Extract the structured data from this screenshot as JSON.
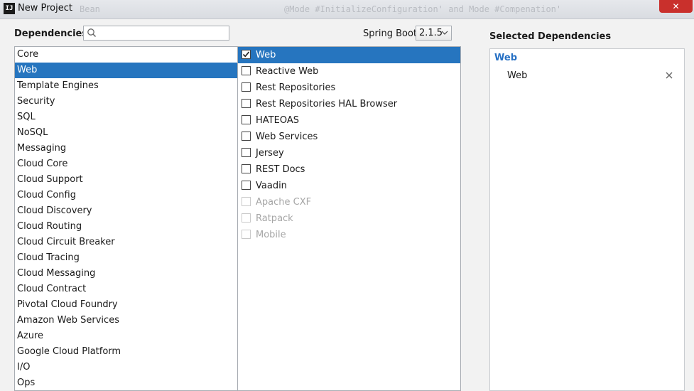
{
  "window": {
    "title": "New Project",
    "close_glyph": "✕",
    "app_icon_text": "IJ"
  },
  "background_ghost": {
    "left_text": "Bean",
    "right_text": "@Mode #InitializeConfiguration' and Mode #Compenation'"
  },
  "header": {
    "dependencies_label": "Dependencies",
    "search": {
      "value": "",
      "icon": "search-icon"
    },
    "spring_boot_label": "Spring Boot",
    "spring_boot_version": "2.1.5"
  },
  "categories": [
    "Core",
    "Web",
    "Template Engines",
    "Security",
    "SQL",
    "NoSQL",
    "Messaging",
    "Cloud Core",
    "Cloud Support",
    "Cloud Config",
    "Cloud Discovery",
    "Cloud Routing",
    "Cloud Circuit Breaker",
    "Cloud Tracing",
    "Cloud Messaging",
    "Cloud Contract",
    "Pivotal Cloud Foundry",
    "Amazon Web Services",
    "Azure",
    "Google Cloud Platform",
    "I/O",
    "Ops"
  ],
  "selected_category_index": 1,
  "dependencies": [
    {
      "label": "Web",
      "checked": true,
      "enabled": true,
      "selected": true
    },
    {
      "label": "Reactive Web",
      "checked": false,
      "enabled": true
    },
    {
      "label": "Rest Repositories",
      "checked": false,
      "enabled": true
    },
    {
      "label": "Rest Repositories HAL Browser",
      "checked": false,
      "enabled": true
    },
    {
      "label": "HATEOAS",
      "checked": false,
      "enabled": true
    },
    {
      "label": "Web Services",
      "checked": false,
      "enabled": true
    },
    {
      "label": "Jersey",
      "checked": false,
      "enabled": true
    },
    {
      "label": "REST Docs",
      "checked": false,
      "enabled": true
    },
    {
      "label": "Vaadin",
      "checked": false,
      "enabled": true
    },
    {
      "label": "Apache CXF",
      "checked": false,
      "enabled": false
    },
    {
      "label": "Ratpack",
      "checked": false,
      "enabled": false
    },
    {
      "label": "Mobile",
      "checked": false,
      "enabled": false
    }
  ],
  "selected_dependencies": {
    "title": "Selected Dependencies",
    "groups": [
      {
        "name": "Web",
        "items": [
          {
            "label": "Web",
            "remove_icon": "close-icon"
          }
        ]
      }
    ]
  },
  "colors": {
    "selection": "#2675bf",
    "group_label": "#2670c4",
    "close_button": "#c9302c"
  }
}
